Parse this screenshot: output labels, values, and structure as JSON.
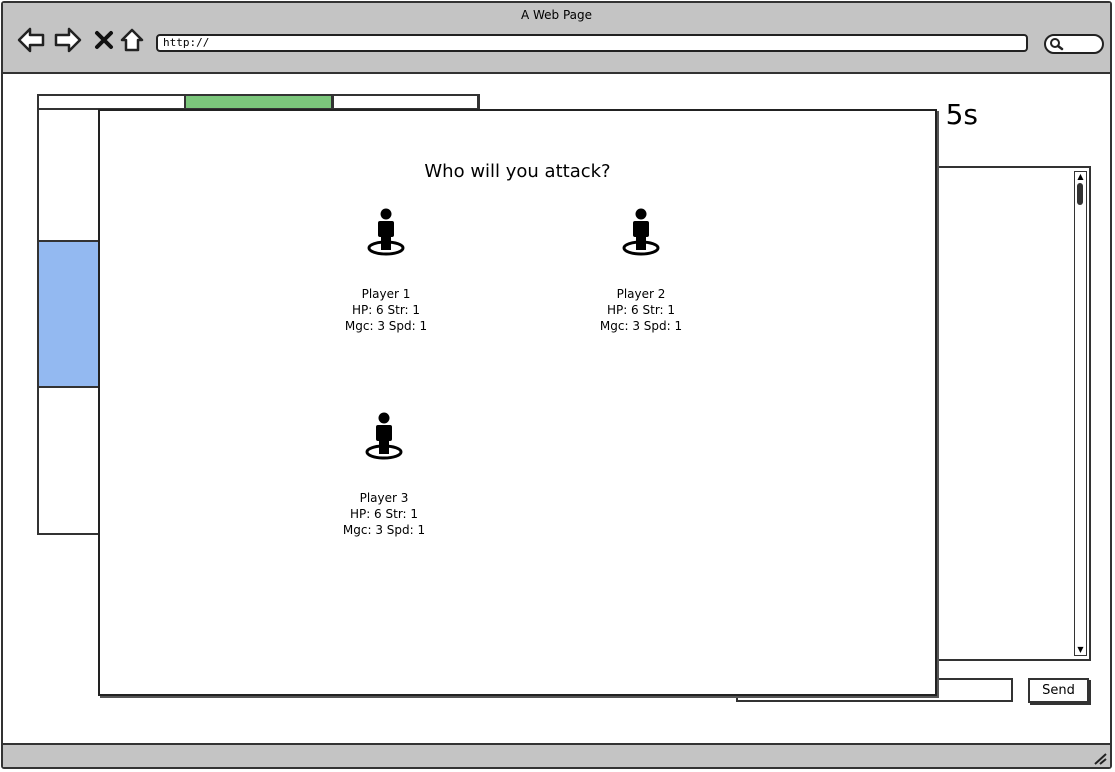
{
  "window": {
    "title": "A Web Page",
    "url": "http://",
    "icons": [
      "back-arrow-icon",
      "forward-arrow-icon",
      "stop-icon",
      "home-icon",
      "search-icon",
      "resize-grip-icon"
    ]
  },
  "background_page": {
    "timer_text": "5s",
    "send_label": "Send",
    "colors": {
      "active_tab": "#7bc67b",
      "highlight_block": "#93b9f1"
    }
  },
  "modal": {
    "title": "Who will you attack?",
    "players": [
      {
        "name": "Player 1",
        "line1": "HP: 6 Str: 1",
        "line2": "Mgc: 3 Spd: 1"
      },
      {
        "name": "Player 2",
        "line1": "HP: 6 Str: 1",
        "line2": "Mgc: 3 Spd: 1"
      },
      {
        "name": "Player 3",
        "line1": "HP: 6 Str: 1",
        "line2": "Mgc: 3 Spd: 1"
      }
    ]
  }
}
